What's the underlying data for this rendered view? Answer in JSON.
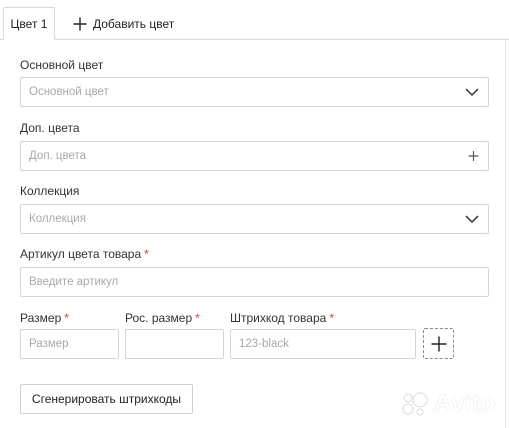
{
  "tabs": {
    "active_label": "Цвет 1",
    "add_label": "Добавить цвет"
  },
  "form": {
    "main_color": {
      "label": "Основной цвет",
      "placeholder": "Основной цвет",
      "trail_icon": "chevron-down-icon"
    },
    "extra_colors": {
      "label": "Доп. цвета",
      "placeholder": "Доп. цвета",
      "trail_icon": "plus-icon"
    },
    "collection": {
      "label": "Коллекция",
      "placeholder": "Коллекция",
      "trail_icon": "chevron-down-icon"
    },
    "article": {
      "label": "Артикул цвета товара",
      "required_mark": "*",
      "placeholder": "Введите артикул"
    },
    "size": {
      "label": "Размер",
      "required_mark": "*",
      "placeholder": "Размер"
    },
    "ru_size": {
      "label": "Рос. размер",
      "required_mark": "*",
      "placeholder": ""
    },
    "barcode": {
      "label": "Штрихкод товара",
      "required_mark": "*",
      "placeholder": "123-black"
    },
    "add_row_icon": "plus-icon",
    "generate_button": "Сгенерировать штрихкоды"
  },
  "watermark": {
    "text": "Avito"
  },
  "colors": {
    "required": "#e03b3b",
    "border": "#d5d5d5",
    "placeholder": "#a8a8a8"
  }
}
